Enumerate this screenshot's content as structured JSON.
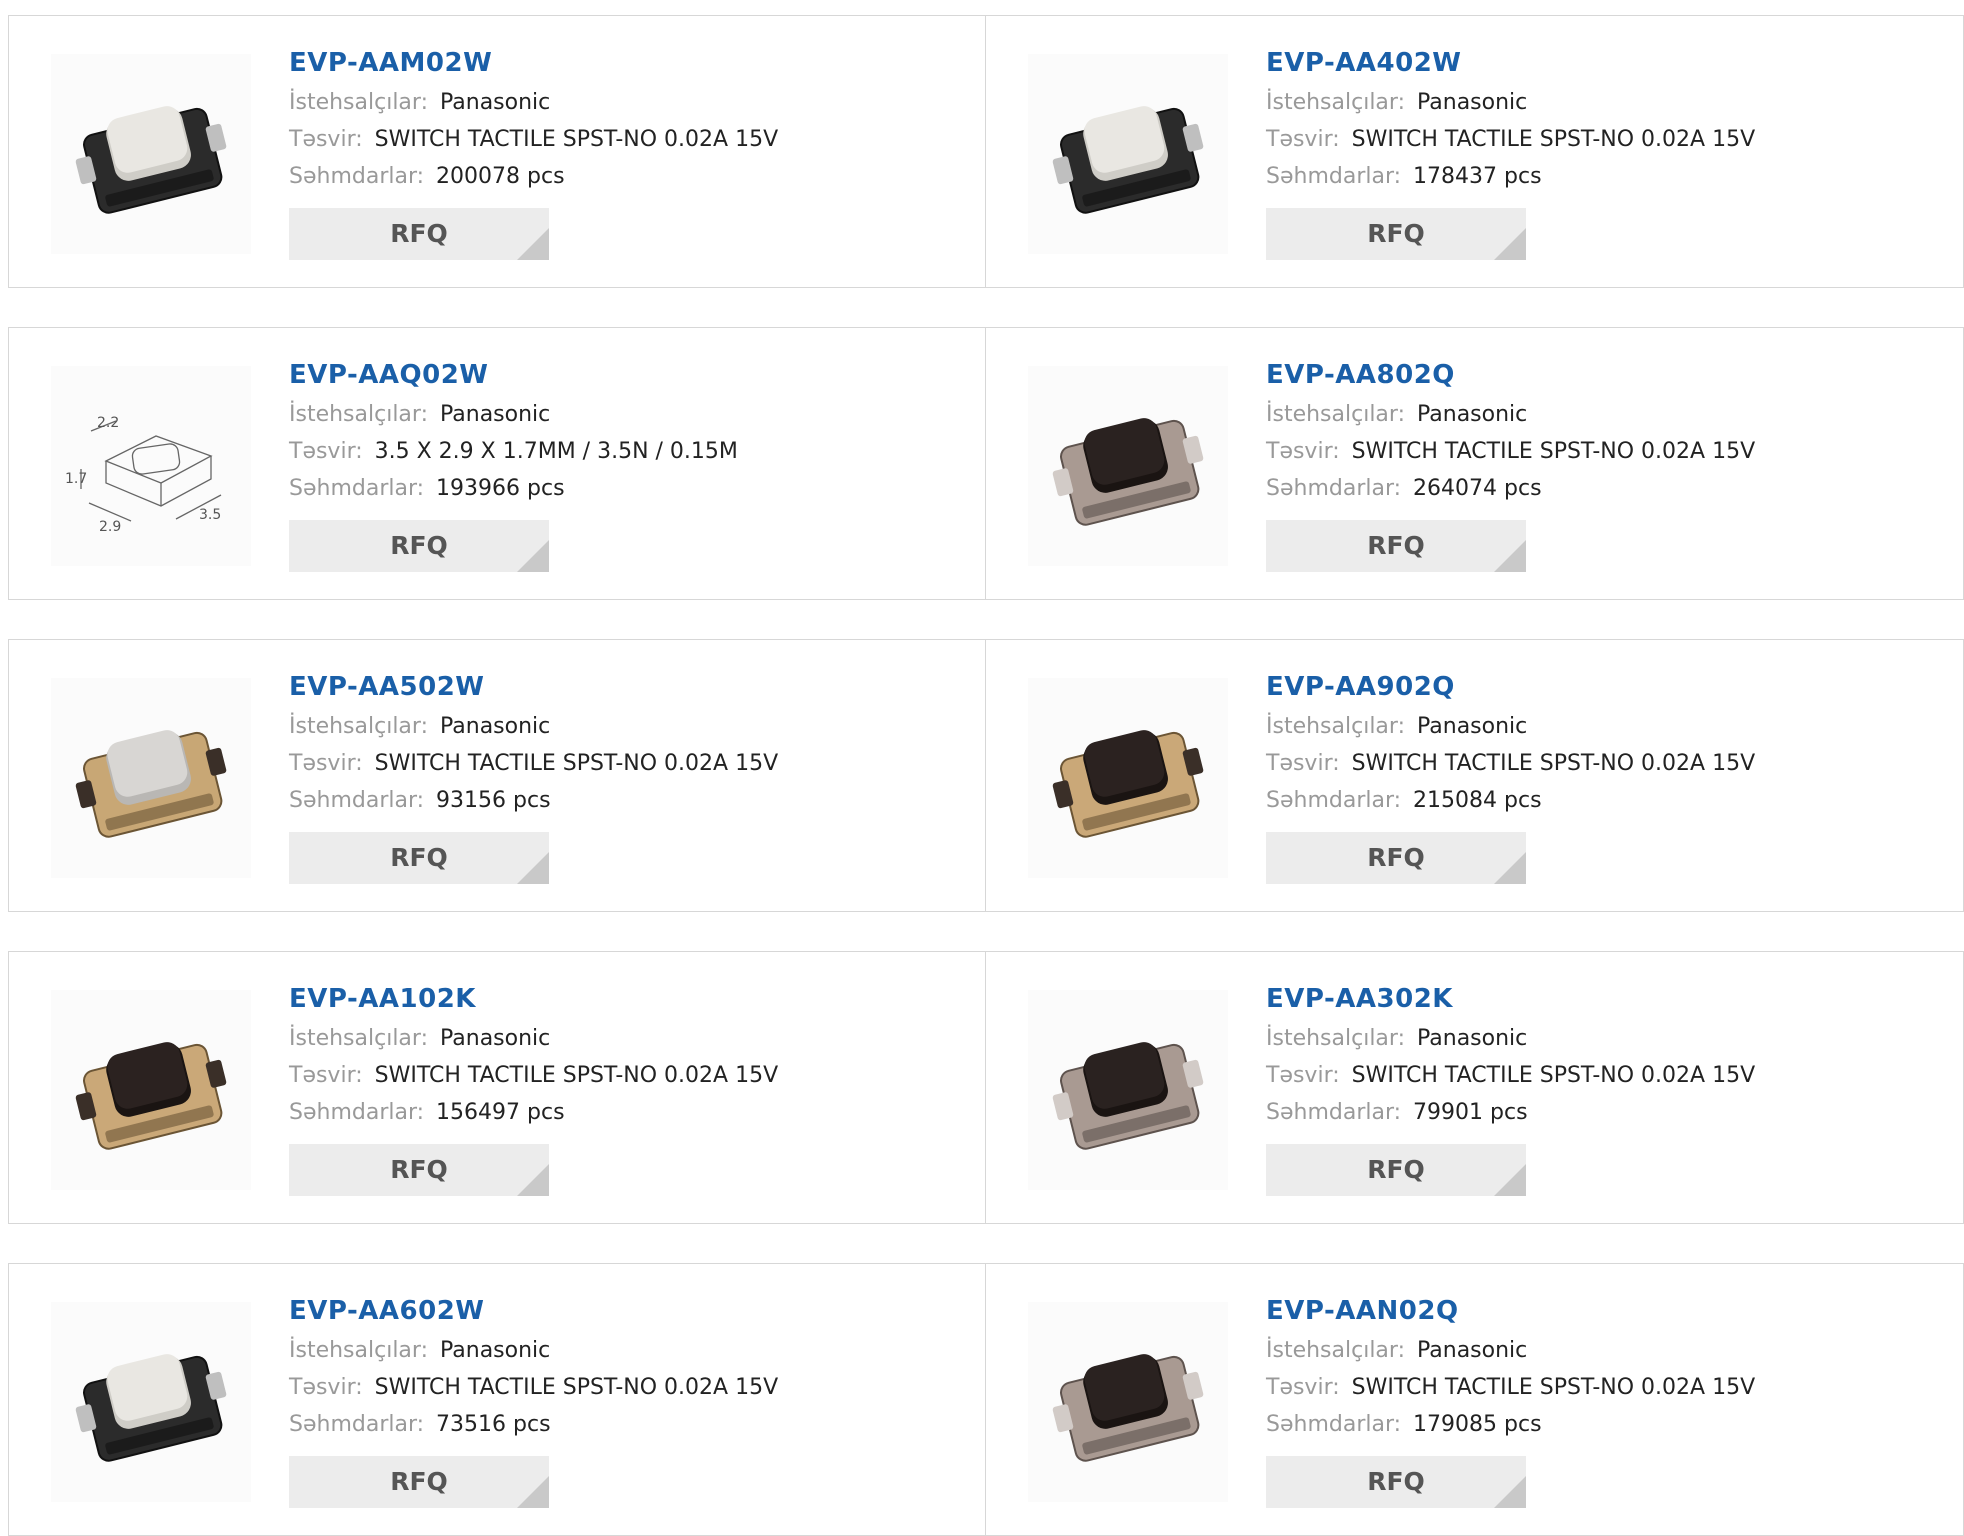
{
  "labels": {
    "manufacturer": "İstehsalçılar:",
    "description": "Təsvir:",
    "stock": "Səhmdarlar:",
    "rfq": "RFQ"
  },
  "colors": {
    "part_link": "#1a5fa8",
    "label": "#999999",
    "rfq_bg": "#ececec",
    "border": "#d7d7d7"
  },
  "products": [
    {
      "part": "EVP-AAM02W",
      "manufacturer": "Panasonic",
      "description": "SWITCH TACTILE SPST-NO 0.02A 15V",
      "stock": "200078 pcs",
      "image": "switch-white-cap-black-body"
    },
    {
      "part": "EVP-AA402W",
      "manufacturer": "Panasonic",
      "description": "SWITCH TACTILE SPST-NO 0.02A 15V",
      "stock": "178437 pcs",
      "image": "switch-white-cap-black-body"
    },
    {
      "part": "EVP-AAQ02W",
      "manufacturer": "Panasonic",
      "description": "3.5 X 2.9 X 1.7MM / 3.5N / 0.15M",
      "stock": "193966 pcs",
      "image": "dimension-drawing"
    },
    {
      "part": "EVP-AA802Q",
      "manufacturer": "Panasonic",
      "description": "SWITCH TACTILE SPST-NO 0.02A 15V",
      "stock": "264074 pcs",
      "image": "switch-black-cap-silver-body"
    },
    {
      "part": "EVP-AA502W",
      "manufacturer": "Panasonic",
      "description": "SWITCH TACTILE SPST-NO 0.02A 15V",
      "stock": "93156 pcs",
      "image": "switch-white-cap-gold-body"
    },
    {
      "part": "EVP-AA902Q",
      "manufacturer": "Panasonic",
      "description": "SWITCH TACTILE SPST-NO 0.02A 15V",
      "stock": "215084 pcs",
      "image": "switch-black-cap-gold-body"
    },
    {
      "part": "EVP-AA102K",
      "manufacturer": "Panasonic",
      "description": "SWITCH TACTILE SPST-NO 0.02A 15V",
      "stock": "156497 pcs",
      "image": "switch-black-cap-gold-body"
    },
    {
      "part": "EVP-AA302K",
      "manufacturer": "Panasonic",
      "description": "SWITCH TACTILE SPST-NO 0.02A 15V",
      "stock": "79901 pcs",
      "image": "switch-black-cap-silver-body"
    },
    {
      "part": "EVP-AA602W",
      "manufacturer": "Panasonic",
      "description": "SWITCH TACTILE SPST-NO 0.02A 15V",
      "stock": "73516 pcs",
      "image": "switch-white-cap-black-body"
    },
    {
      "part": "EVP-AAN02Q",
      "manufacturer": "Panasonic",
      "description": "SWITCH TACTILE SPST-NO 0.02A 15V",
      "stock": "179085 pcs",
      "image": "switch-black-cap-silver-body"
    }
  ],
  "dimension_drawing": {
    "dims": [
      "2.2",
      "1.7",
      "2.9",
      "3.5"
    ]
  }
}
